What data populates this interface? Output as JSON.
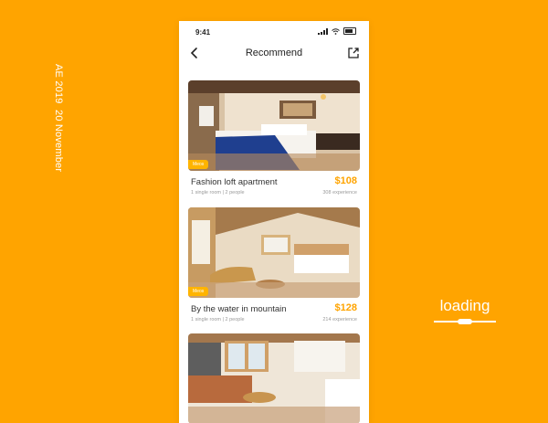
{
  "side_caption": {
    "line1": "AE 2019",
    "line2": "20 November"
  },
  "loading": {
    "label": "loading"
  },
  "status_bar": {
    "time": "9:41"
  },
  "nav": {
    "title": "Recommend"
  },
  "listings": [
    {
      "title": "Fashion loft apartment",
      "details": "1 single room | 2 people",
      "price": "$108",
      "experience": "308 experience",
      "tag": "Meos"
    },
    {
      "title": "By the water in mountain",
      "details": "1 single room | 2 people",
      "price": "$128",
      "experience": "214 experience",
      "tag": "Meos"
    }
  ],
  "colors": {
    "background": "#FFA400",
    "accent": "#FFA400",
    "tag": "#FFB400"
  }
}
